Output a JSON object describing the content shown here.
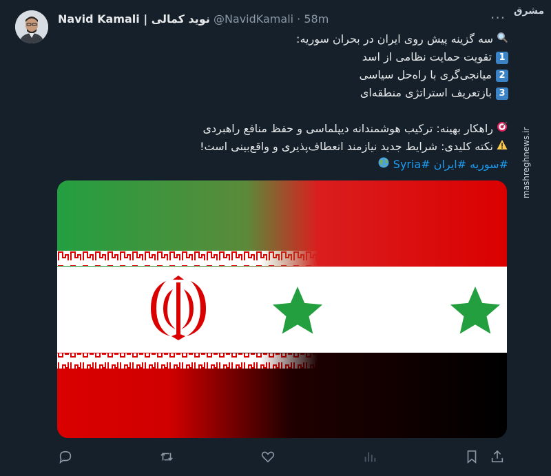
{
  "author": {
    "display_name": "Navid Kamali | نوید کمالی",
    "handle": "@NavidKamali",
    "separator": "·",
    "time": "58m"
  },
  "watermark": {
    "logo": "مشرق",
    "url": "mashreghnews.ir"
  },
  "tweet": {
    "intro": "سه گزینه پیش روی ایران در بحران سوریه:",
    "options": [
      {
        "num": "1",
        "text": "تقویت حمایت نظامی از اسد"
      },
      {
        "num": "2",
        "text": "میانجی‌گری با راه‌حل سیاسی"
      },
      {
        "num": "3",
        "text": "بازتعریف استراتژی منطقه‌ای"
      }
    ],
    "strategy": "راهکار بهینه: ترکیب هوشمندانه دیپلماسی و حفظ منافع راهبردی",
    "note": "نکته کلیدی: شرایط جدید نیازمند انعطاف‌پذیری و واقع‌بینی است!",
    "hashtags": [
      "#سوریه",
      "#ایران",
      "#Syria"
    ]
  },
  "icons": {
    "intro": "magnifier-icon",
    "strategy": "target-icon",
    "note": "warning-icon",
    "globe": "globe-icon"
  },
  "colors": {
    "background": "#15202b",
    "text": "#e7e9ea",
    "muted": "#8b98a5",
    "link": "#1d9bf0",
    "iran_green": "#239f40",
    "flag_white": "#ffffff",
    "flag_red": "#da0000",
    "syria_star": "#239f40",
    "syria_black": "#000000"
  }
}
